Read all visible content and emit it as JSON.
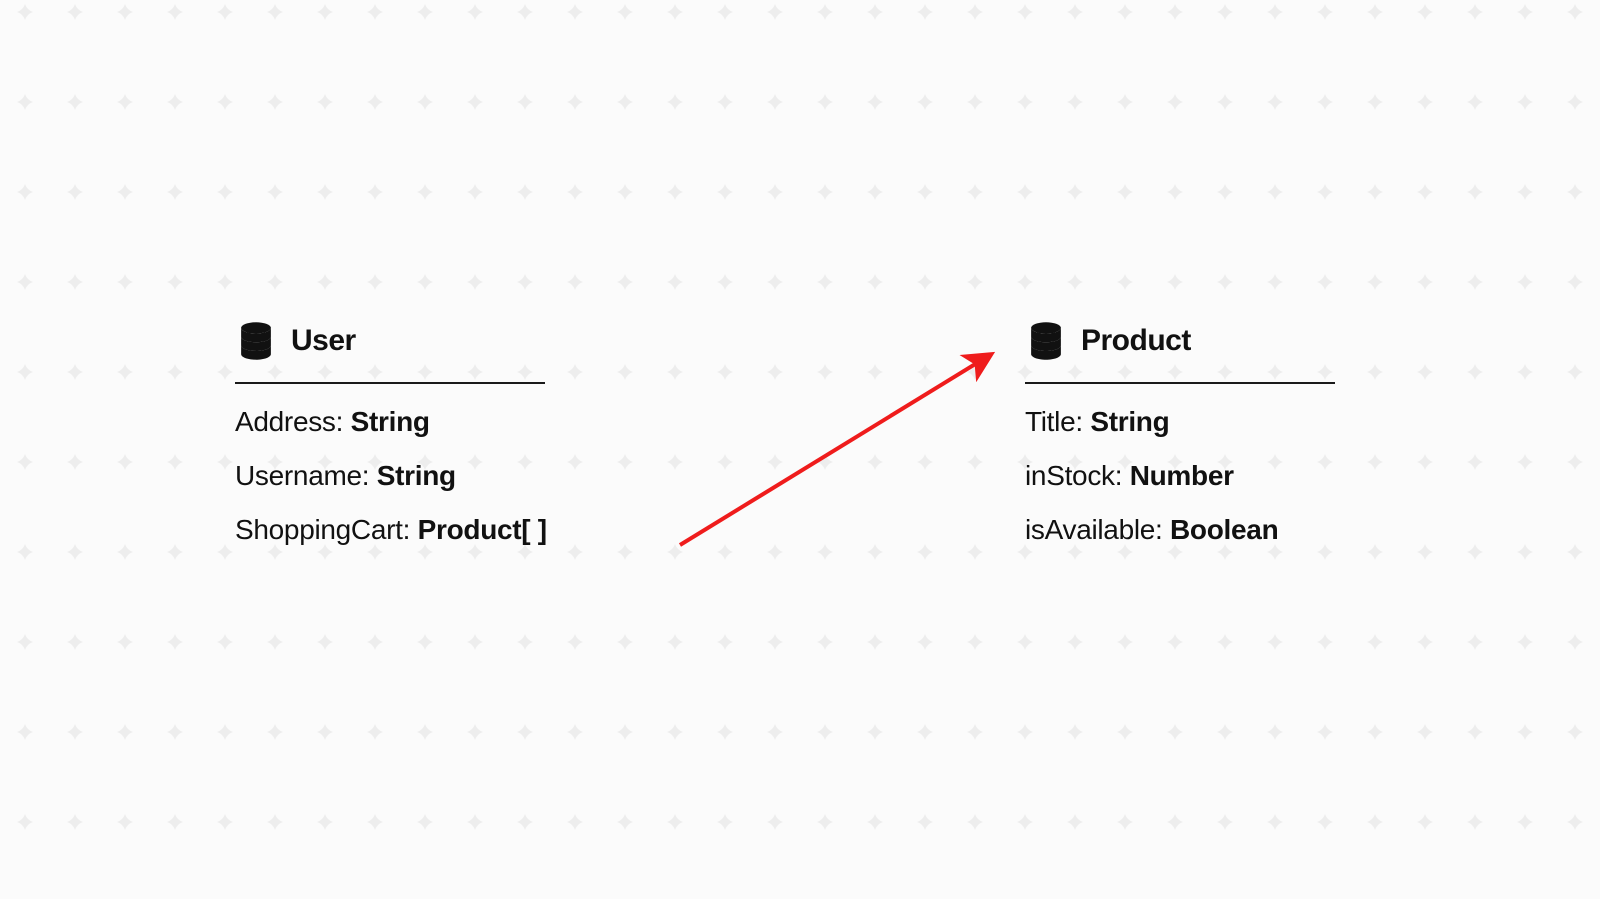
{
  "entities": {
    "user": {
      "title": "User",
      "fields": [
        {
          "name": "Address",
          "type": "String"
        },
        {
          "name": "Username",
          "type": "String"
        },
        {
          "name": "ShoppingCart",
          "type": "Product[ ]"
        }
      ]
    },
    "product": {
      "title": "Product",
      "fields": [
        {
          "name": "Title",
          "type": "String"
        },
        {
          "name": "inStock",
          "type": "Number"
        },
        {
          "name": "isAvailable",
          "type": "Boolean"
        }
      ]
    }
  },
  "arrow": {
    "color": "#EF1C1C",
    "from": "user.ShoppingCart",
    "to": "product"
  }
}
